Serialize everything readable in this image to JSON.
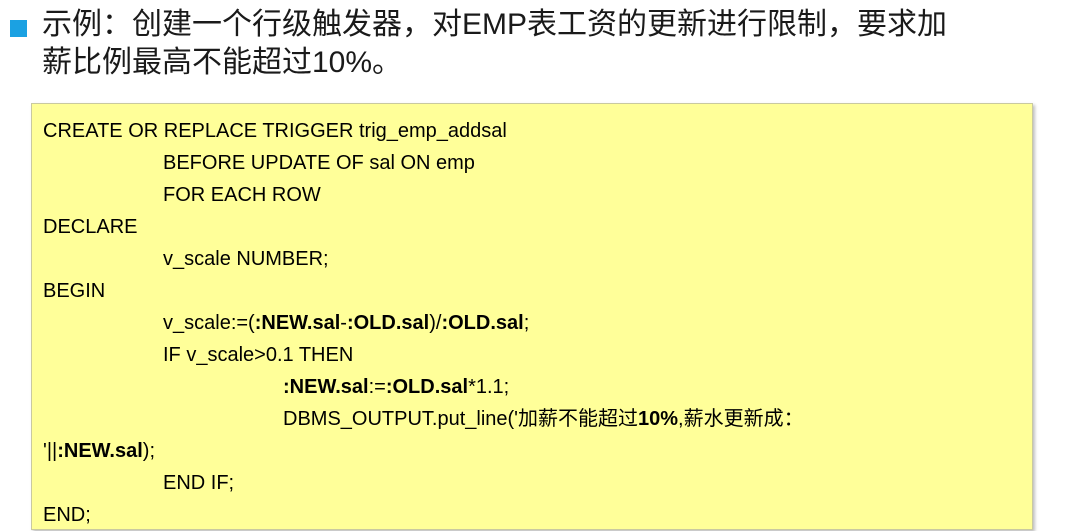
{
  "heading": {
    "text_line1": "示例：创建一个行级触发器，对EMP表工资的更新进行限制，要求加",
    "text_line2": "薪比例最高不能超过10%。",
    "bullet_color": "#1ba1e2"
  },
  "code": {
    "background": "#ffff99",
    "l1": "CREATE OR REPLACE TRIGGER trig_emp_addsal",
    "l2": "BEFORE UPDATE OF sal ON emp",
    "l3": "FOR EACH ROW",
    "l4": "DECLARE",
    "l5": "v_scale NUMBER;",
    "l6": "BEGIN",
    "l7": {
      "a": "v_scale:=(",
      "b": ":NEW.sal",
      "c": "-",
      "d": ":OLD.sal",
      "e": ")/",
      "f": ":OLD.sal",
      "g": ";"
    },
    "l8": "IF v_scale>0.1 THEN",
    "l9": {
      "a": ":NEW.sal",
      "b": ":=",
      "c": ":OLD.sal",
      "d": "*1.1;"
    },
    "l10": {
      "a": "DBMS_OUTPUT.put_line('加薪不能超过",
      "b": "10%",
      "c": ",薪水更新成："
    },
    "l11": {
      "a": "'||",
      "b": ":NEW.sal",
      "c": ");"
    },
    "l12": "END IF;",
    "l13": "END;"
  }
}
